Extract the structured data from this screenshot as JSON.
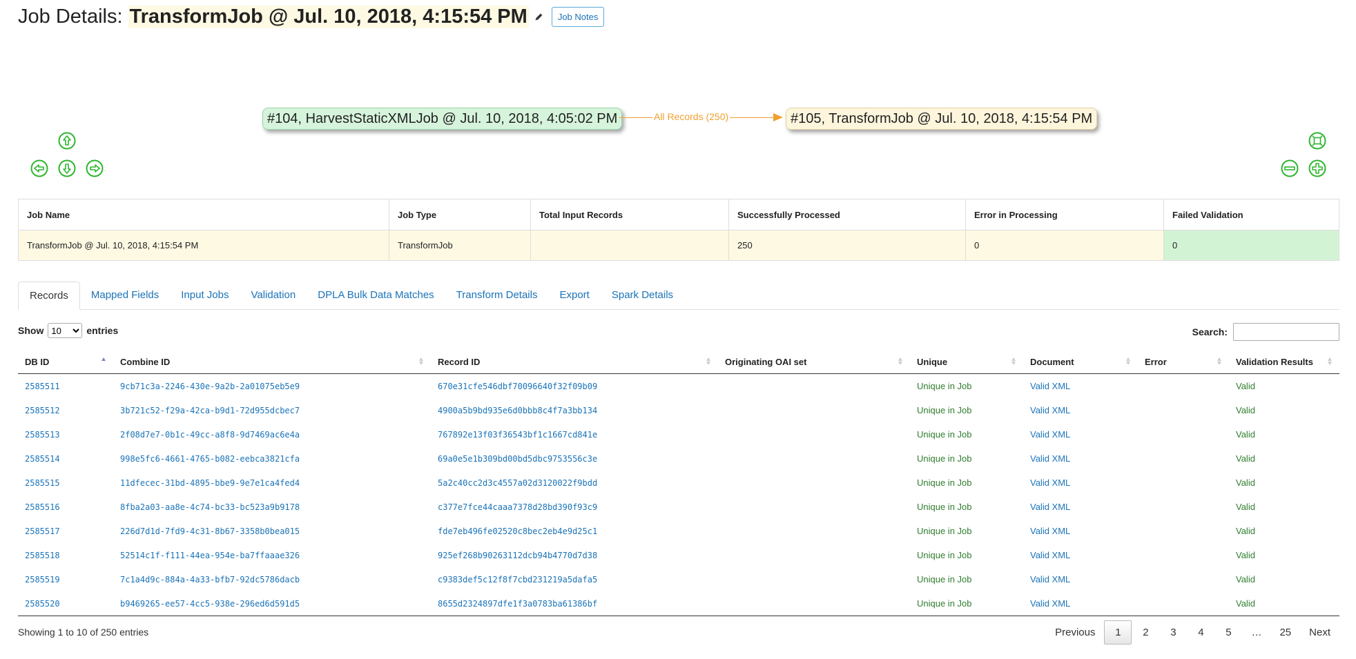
{
  "header": {
    "prefix": "Job Details:",
    "job_name": "TransformJob @ Jul. 10, 2018, 4:15:54 PM",
    "notes_button": "Job Notes"
  },
  "graph": {
    "source_node": "#104, HarvestStaticXMLJob @ Jul. 10, 2018, 4:05:02 PM",
    "target_node": "#105, TransformJob @ Jul. 10, 2018, 4:15:54 PM",
    "edge_label": "All Records (250)",
    "edge_color": "#f0a030",
    "node_colors": {
      "source": "#d6f4dc",
      "target": "#fdf6dc"
    },
    "controls": [
      "pan-up-icon",
      "pan-left-icon",
      "pan-down-icon",
      "pan-right-icon",
      "zoom-fit-icon",
      "zoom-out-icon",
      "zoom-in-icon"
    ]
  },
  "summary": {
    "headers": [
      "Job Name",
      "Job Type",
      "Total Input Records",
      "Successfully Processed",
      "Error in Processing",
      "Failed Validation"
    ],
    "row": [
      "TransformJob @ Jul. 10, 2018, 4:15:54 PM",
      "TransformJob",
      "",
      "250",
      "0",
      "0"
    ]
  },
  "tabs": [
    "Records",
    "Mapped Fields",
    "Input Jobs",
    "Validation",
    "DPLA Bulk Data Matches",
    "Transform Details",
    "Export",
    "Spark Details"
  ],
  "active_tab": "Records",
  "records": {
    "length_prefix": "Show",
    "length_value": "10",
    "length_suffix": "entries",
    "search_label": "Search:",
    "search_value": "",
    "columns": [
      "DB ID",
      "Combine ID",
      "Record ID",
      "Originating OAI set",
      "Unique",
      "Document",
      "Error",
      "Validation Results"
    ],
    "sorted_column": "DB ID",
    "rows": [
      [
        "2585511",
        "9cb71c3a-2246-430e-9a2b-2a01075eb5e9",
        "670e31cfe546dbf70096640f32f09b09",
        "",
        "Unique in Job",
        "Valid XML",
        "",
        "Valid"
      ],
      [
        "2585512",
        "3b721c52-f29a-42ca-b9d1-72d955dcbec7",
        "4900a5b9bd935e6d0bbb8c4f7a3bb134",
        "",
        "Unique in Job",
        "Valid XML",
        "",
        "Valid"
      ],
      [
        "2585513",
        "2f08d7e7-0b1c-49cc-a8f8-9d7469ac6e4a",
        "767892e13f03f36543bf1c1667cd841e",
        "",
        "Unique in Job",
        "Valid XML",
        "",
        "Valid"
      ],
      [
        "2585514",
        "998e5fc6-4661-4765-b082-eebca3821cfa",
        "69a0e5e1b309bd00bd5dbc9753556c3e",
        "",
        "Unique in Job",
        "Valid XML",
        "",
        "Valid"
      ],
      [
        "2585515",
        "11dfecec-31bd-4895-bbe9-9e7e1ca4fed4",
        "5a2c40cc2d3c4557a02d3120022f9bdd",
        "",
        "Unique in Job",
        "Valid XML",
        "",
        "Valid"
      ],
      [
        "2585516",
        "8fba2a03-aa8e-4c74-bc33-bc523a9b9178",
        "c377e7fce44caaa7378d28bd390f93c9",
        "",
        "Unique in Job",
        "Valid XML",
        "",
        "Valid"
      ],
      [
        "2585517",
        "226d7d1d-7fd9-4c31-8b67-3358b0bea015",
        "fde7eb496fe02520c8bec2eb4e9d25c1",
        "",
        "Unique in Job",
        "Valid XML",
        "",
        "Valid"
      ],
      [
        "2585518",
        "52514c1f-f111-44ea-954e-ba7ffaaae326",
        "925ef268b90263112dcb94b4770d7d38",
        "",
        "Unique in Job",
        "Valid XML",
        "",
        "Valid"
      ],
      [
        "2585519",
        "7c1a4d9c-884a-4a33-bfb7-92dc5786dacb",
        "c9383def5c12f8f7cbd231219a5dafa5",
        "",
        "Unique in Job",
        "Valid XML",
        "",
        "Valid"
      ],
      [
        "2585520",
        "b9469265-ee57-4cc5-938e-296ed6d591d5",
        "8655d2324897dfe1f3a0783ba61386bf",
        "",
        "Unique in Job",
        "Valid XML",
        "",
        "Valid"
      ]
    ],
    "info": "Showing 1 to 10 of 250 entries",
    "pagination": [
      "Previous",
      "1",
      "2",
      "3",
      "4",
      "5",
      "…",
      "25",
      "Next"
    ],
    "current_page": "1"
  },
  "colors": {
    "link": "#1a73b8",
    "success_green": "#2f7d2f",
    "highlight_yellow": "#fdf9e3",
    "highlight_green": "#d3f3d5",
    "nav_button_green": "#2fb52f"
  }
}
